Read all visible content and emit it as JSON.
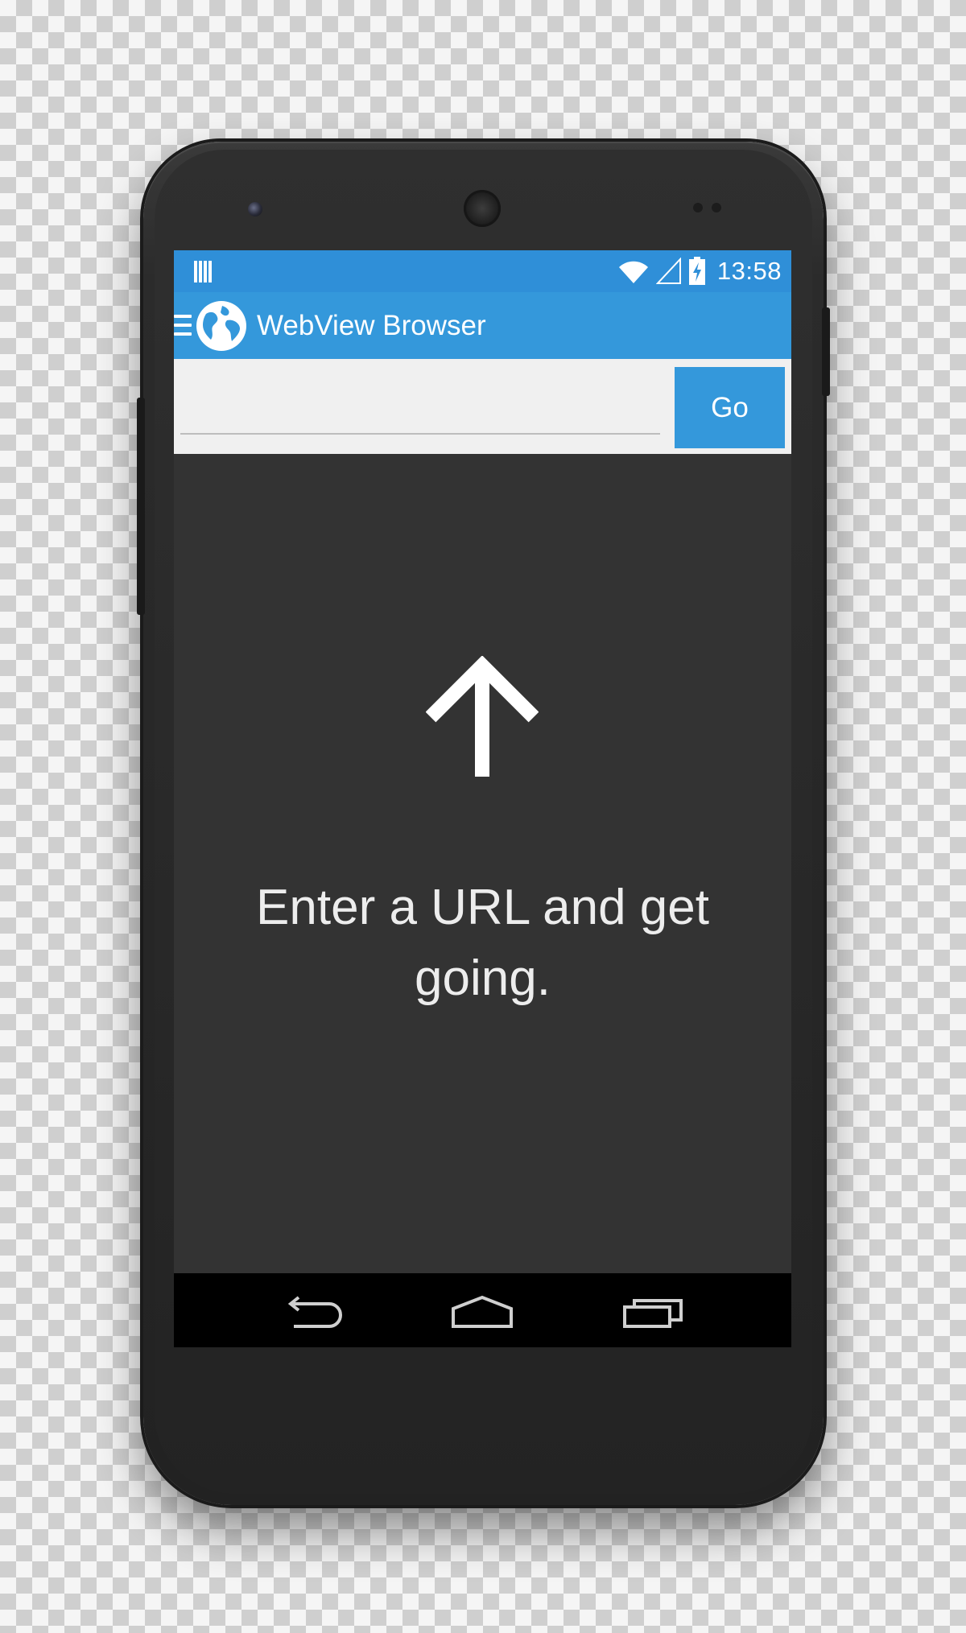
{
  "status_bar": {
    "time": "13:58",
    "icons": [
      "notification-icon",
      "wifi-icon",
      "signal-icon",
      "battery-charging-icon"
    ]
  },
  "action_bar": {
    "title": "WebView Browser",
    "icons": [
      "menu-icon",
      "globe-icon"
    ]
  },
  "url_bar": {
    "value": "",
    "go_label": "Go"
  },
  "content": {
    "icon": "arrow-up-icon",
    "hint": "Enter a URL and get going."
  },
  "nav_bar": {
    "icons": [
      "back-icon",
      "home-icon",
      "recents-icon"
    ]
  },
  "colors": {
    "accent": "#3498db",
    "status_bar": "#2f8fd8",
    "content_bg": "#333333",
    "url_bar_bg": "#f0f0f0",
    "nav_bar_bg": "#000000"
  }
}
